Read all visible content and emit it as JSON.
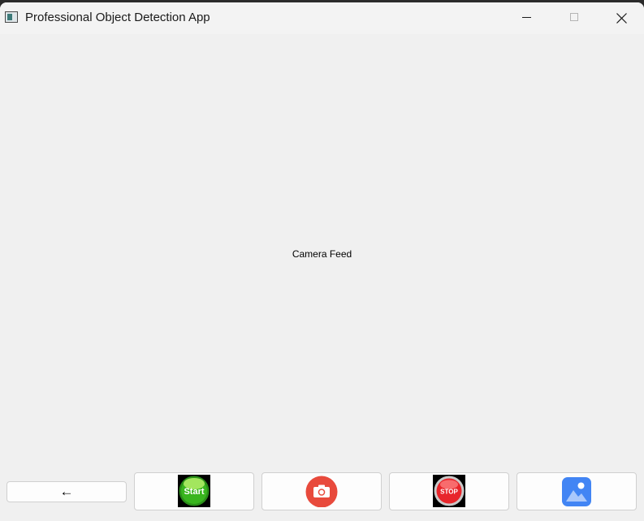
{
  "window": {
    "title": "Professional Object Detection App"
  },
  "camera_feed": {
    "label": "Camera Feed"
  },
  "controls": {
    "back_label": "←",
    "start_icon_text": "Start",
    "stop_icon_text": "STOP"
  },
  "icons": {
    "app": "app-window-icon",
    "minimize": "minimize-icon",
    "maximize": "maximize-icon",
    "close": "close-icon",
    "start": "start-icon",
    "capture": "camera-icon",
    "stop": "stop-icon",
    "gallery": "image-icon"
  },
  "colors": {
    "start_green": "#2fa01c",
    "camera_red": "#e84a3c",
    "stop_red": "#e8262b",
    "gallery_blue": "#4285f4"
  }
}
